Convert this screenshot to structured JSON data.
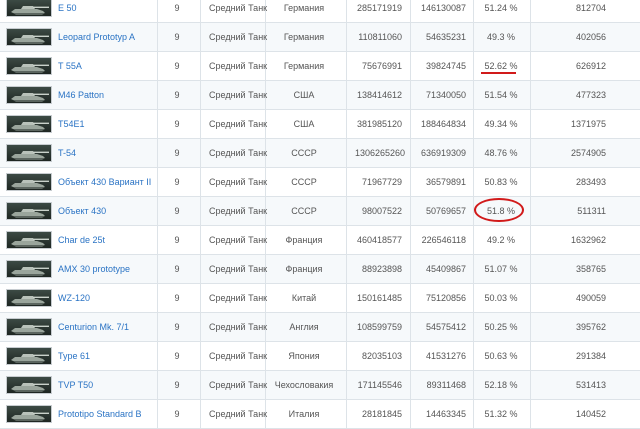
{
  "tanks": [
    {
      "name": "E 50",
      "tier": "9",
      "type": "Средний Танк",
      "nation": "Германия",
      "battles": "285171919",
      "wins": "146130087",
      "winrate": "51.24 %",
      "extra": "812704"
    },
    {
      "name": "Leopard Prototyp A",
      "tier": "9",
      "type": "Средний Танк",
      "nation": "Германия",
      "battles": "110811060",
      "wins": "54635231",
      "winrate": "49.3 %",
      "extra": "402056"
    },
    {
      "name": "T 55A",
      "tier": "9",
      "type": "Средний Танк",
      "nation": "Германия",
      "battles": "75676991",
      "wins": "39824745",
      "winrate": "52.62 %",
      "extra": "626912",
      "mark": "underline"
    },
    {
      "name": "M46 Patton",
      "tier": "9",
      "type": "Средний Танк",
      "nation": "США",
      "battles": "138414612",
      "wins": "71340050",
      "winrate": "51.54 %",
      "extra": "477323"
    },
    {
      "name": "T54E1",
      "tier": "9",
      "type": "Средний Танк",
      "nation": "США",
      "battles": "381985120",
      "wins": "188464834",
      "winrate": "49.34 %",
      "extra": "1371975"
    },
    {
      "name": "T-54",
      "tier": "9",
      "type": "Средний Танк",
      "nation": "СССР",
      "battles": "1306265260",
      "wins": "636919309",
      "winrate": "48.76 %",
      "extra": "2574905"
    },
    {
      "name": "Объект 430 Вариант II",
      "tier": "9",
      "type": "Средний Танк",
      "nation": "СССР",
      "battles": "71967729",
      "wins": "36579891",
      "winrate": "50.83 %",
      "extra": "283493"
    },
    {
      "name": "Объект 430",
      "tier": "9",
      "type": "Средний Танк",
      "nation": "СССР",
      "battles": "98007522",
      "wins": "50769657",
      "winrate": "51.8 %",
      "extra": "511311",
      "mark": "circle"
    },
    {
      "name": "Char de 25t",
      "tier": "9",
      "type": "Средний Танк",
      "nation": "Франция",
      "battles": "460418577",
      "wins": "226546118",
      "winrate": "49.2 %",
      "extra": "1632962"
    },
    {
      "name": "AMX 30 prototype",
      "tier": "9",
      "type": "Средний Танк",
      "nation": "Франция",
      "battles": "88923898",
      "wins": "45409867",
      "winrate": "51.07 %",
      "extra": "358765"
    },
    {
      "name": "WZ-120",
      "tier": "9",
      "type": "Средний Танк",
      "nation": "Китай",
      "battles": "150161485",
      "wins": "75120856",
      "winrate": "50.03 %",
      "extra": "490059"
    },
    {
      "name": "Centurion Mk. 7/1",
      "tier": "9",
      "type": "Средний Танк",
      "nation": "Англия",
      "battles": "108599759",
      "wins": "54575412",
      "winrate": "50.25 %",
      "extra": "395762"
    },
    {
      "name": "Type 61",
      "tier": "9",
      "type": "Средний Танк",
      "nation": "Япония",
      "battles": "82035103",
      "wins": "41531276",
      "winrate": "50.63 %",
      "extra": "291384"
    },
    {
      "name": "TVP T50",
      "tier": "9",
      "type": "Средний Танк",
      "nation": "Чехословакия",
      "battles": "171145546",
      "wins": "89311468",
      "winrate": "52.18 %",
      "extra": "531413"
    },
    {
      "name": "Prototipo Standard B",
      "tier": "9",
      "type": "Средний Танк",
      "nation": "Италия",
      "battles": "28181845",
      "wins": "14463345",
      "winrate": "51.32 %",
      "extra": "140452"
    }
  ],
  "colors": {
    "link": "#2a73c4",
    "annotation": "#d11a1a",
    "grid": "#dde3e8"
  },
  "icons": {
    "tank_thumbnail": "tank-thumbnail-icon"
  }
}
